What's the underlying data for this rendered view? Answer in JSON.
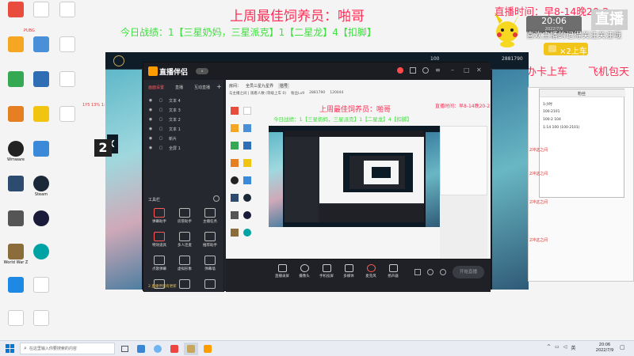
{
  "overlay": {
    "top_line": "上周最佳饲养员：啪哥",
    "record_line": "今日战绩：1【三星奶妈，三星派克】1【二星龙】4【扣脚】",
    "live_time": "直播时间：早8-14晚20-2",
    "clock": "20:06",
    "clock_date": "2022/7/9",
    "scroll_text": "喜欢主播的记得关注关注哦",
    "car_text": "×2上车",
    "card_text": "办卡上车",
    "free_text": "飞机包天",
    "live_badge": "直播"
  },
  "desktop_icons": [
    "",
    "",
    "",
    "",
    "",
    "Wmware",
    "",
    "Steam",
    "",
    "",
    "World War Z",
    "",
    "",
    "",
    "",
    "",
    "",
    ""
  ],
  "top_notes": {
    "red_note": "PUBG",
    "dark_note": "1Y5 13% 1:10"
  },
  "game": {
    "player_name": "2881790",
    "left_digit": "2",
    "count": "100"
  },
  "stream_app": {
    "logo": "直播伴侣",
    "version": "v",
    "tabs": [
      "画面设置",
      "直播",
      "互动直播"
    ],
    "scenes": [
      "文本 4",
      "文本 3",
      "文本 2",
      "文本 1",
      "新片",
      "全屏 1"
    ],
    "tools_title": "工具栏",
    "tools": [
      "弹幕助手",
      "房管助手",
      "主播任务",
      "特效道具",
      "多人连麦",
      "推荐助手",
      "点歌弹幕",
      "虚拟形象",
      "弹幕墙",
      "直播回放",
      "",
      ""
    ],
    "bottom_tools": [
      "直播录屏",
      "摄像头",
      "手机投屏",
      "多媒体",
      "麦克风",
      "扬声器"
    ],
    "start_button": "开始直播",
    "footer": "2.直播伴侣有更新",
    "top_info": [
      "房间：",
      "全员三星九星界",
      "信号",
      "粉丝Lv9",
      "2881790",
      "120044"
    ],
    "sub_bar": "与主播之间 | 观看人数 (等级上车 0)"
  },
  "right_window": {
    "title": "粉丝",
    "items": [
      "1小时",
      "100·2101",
      "100·2 104",
      "1:14 100 (100·2101)"
    ],
    "links": [
      "2冲这之间",
      "2冲这之间",
      "2冲这之间",
      "2冲这之间"
    ]
  },
  "taskbar": {
    "search_placeholder": "在这里输入你要搜索的内容",
    "time": "20:06",
    "date": "2022/7/9",
    "lang": "英"
  }
}
